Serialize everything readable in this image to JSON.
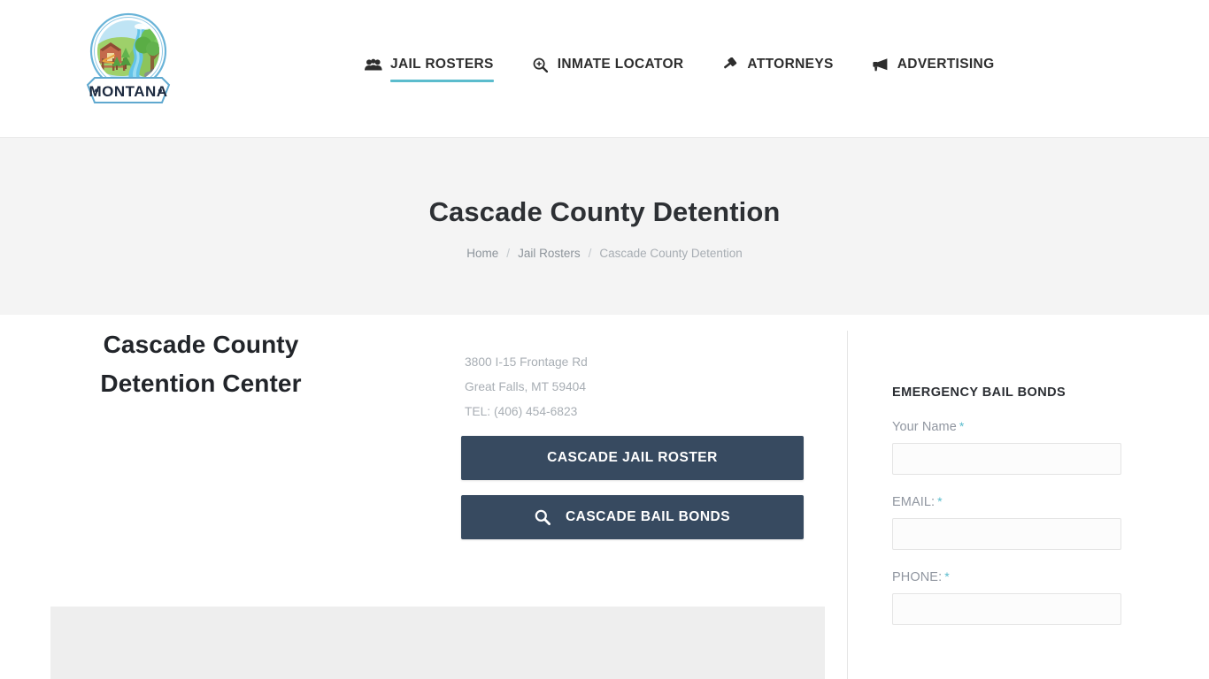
{
  "header": {
    "logo": {
      "name": "montana-logo",
      "banner_text": "MONTANA"
    },
    "nav": [
      {
        "label": "JAIL ROSTERS",
        "icon": "users-icon",
        "active": true
      },
      {
        "label": "INMATE LOCATOR",
        "icon": "search-plus-icon",
        "active": false
      },
      {
        "label": "ATTORNEYS",
        "icon": "gavel-icon",
        "active": false
      },
      {
        "label": "ADVERTISING",
        "icon": "bullhorn-icon",
        "active": false
      }
    ]
  },
  "banner": {
    "title": "Cascade County Detention",
    "breadcrumb": [
      {
        "label": "Home"
      },
      {
        "label": "Jail Rosters"
      },
      {
        "label": "Cascade County Detention"
      }
    ],
    "separator": "/"
  },
  "main": {
    "facility_name_line1": "Cascade County",
    "facility_name_line2": "Detention Center",
    "address_line1": "3800 I-15 Frontage Rd",
    "address_line2": "Great Falls, MT 59404",
    "address_phone": "TEL: (406) 454-6823",
    "buttons": [
      {
        "label": "CASCADE JAIL ROSTER",
        "icon": "none"
      },
      {
        "label": "CASCADE BAIL BONDS",
        "icon": "search-icon"
      }
    ]
  },
  "sidebar": {
    "title": "EMERGENCY BAIL BONDS",
    "required_marker": "*",
    "fields": [
      {
        "label": "Your Name",
        "value": "",
        "placeholder": ""
      },
      {
        "label": "EMAIL:",
        "value": "",
        "placeholder": ""
      },
      {
        "label": "PHONE:",
        "value": "",
        "placeholder": ""
      }
    ]
  },
  "colors": {
    "accent_teal": "#5bbccd",
    "button_navy": "#374a60",
    "banner_bg": "#f4f4f4",
    "gray_block": "#eeeeee",
    "text_dark": "#22252a",
    "text_muted": "#a8aeb4"
  }
}
